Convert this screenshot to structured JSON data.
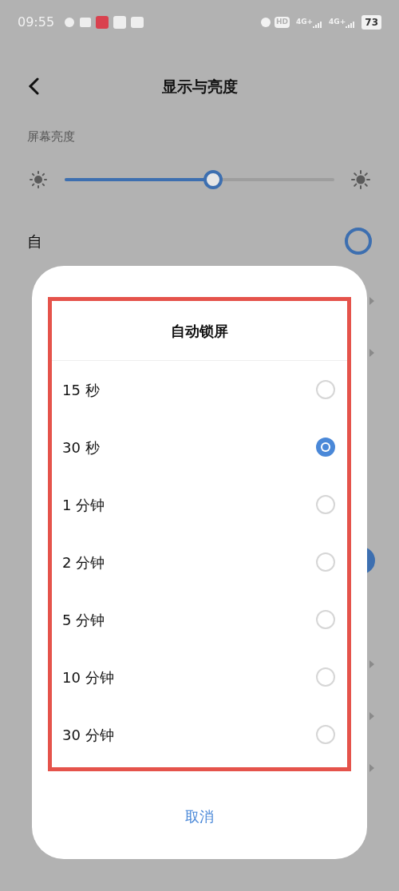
{
  "status_bar": {
    "time": "09:55",
    "hd": "HD",
    "networks": [
      "4G+",
      "4G+"
    ],
    "battery": "73"
  },
  "header": {
    "title": "显示与亮度"
  },
  "brightness": {
    "label": "屏幕亮度",
    "level": 0.55
  },
  "auto_row": {
    "label": "自",
    "on": false
  },
  "rows": [
    {
      "kind": "chevron"
    },
    {
      "kind": "chevron"
    },
    {
      "kind": "blank"
    },
    {
      "kind": "blank"
    },
    {
      "kind": "blank"
    },
    {
      "kind": "toggle",
      "on": true
    },
    {
      "kind": "blank"
    },
    {
      "kind": "chevron"
    },
    {
      "kind": "chevron"
    },
    {
      "kind": "chevron"
    }
  ],
  "dialog": {
    "title": "自动锁屏",
    "options": [
      {
        "label": "15 秒",
        "selected": false
      },
      {
        "label": "30 秒",
        "selected": true
      },
      {
        "label": "1 分钟",
        "selected": false
      },
      {
        "label": "2 分钟",
        "selected": false
      },
      {
        "label": "5 分钟",
        "selected": false
      },
      {
        "label": "10 分钟",
        "selected": false
      },
      {
        "label": "30 分钟",
        "selected": false
      }
    ],
    "cancel": "取消"
  }
}
